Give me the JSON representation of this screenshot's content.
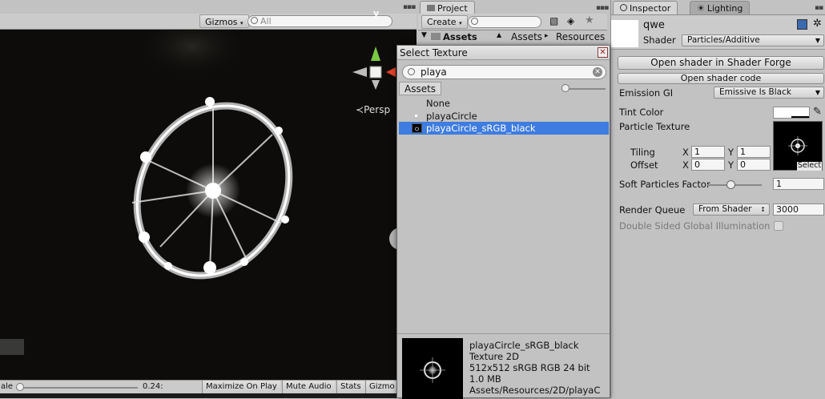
{
  "scene": {
    "gizmos_label": "Gizmos",
    "search_placeholder": "All",
    "persp_label": "Persp",
    "axis_y_label": "y"
  },
  "game_bar": {
    "scale_label": "ale",
    "scale_value": "0.24:",
    "maximize_label": "Maximize On Play",
    "mute_label": "Mute Audio",
    "stats_label": "Stats",
    "gizmos_label": "Gizmo"
  },
  "project": {
    "tab_label": "Project",
    "create_label": "Create",
    "path_root": "Assets",
    "breadcrumb": [
      "Assets",
      "Resources"
    ]
  },
  "dialog": {
    "title": "Select Texture",
    "search_value": "playa",
    "assets_tab": "Assets",
    "items": [
      {
        "label": "None",
        "selected": false
      },
      {
        "label": "playaCircle",
        "selected": false
      },
      {
        "label": "playaCircle_sRGB_black",
        "selected": true
      }
    ],
    "info": [
      "playaCircle_sRGB_black",
      "Texture 2D",
      "512x512 sRGB  RGB 24 bit",
      "1.0 MB",
      "Assets/Resources/2D/playaC"
    ]
  },
  "inspector": {
    "tab_inspector": "Inspector",
    "tab_lighting": "Lighting",
    "material_name": "qwe",
    "shader_label": "Shader",
    "shader_value": "Particles/Additive",
    "btn_shader_forge": "Open shader in Shader Forge",
    "btn_shader_code": "Open shader code",
    "emission_label": "Emission GI",
    "emission_value": "Emissive Is Black",
    "tint_label": "Tint Color",
    "particle_texture_label": "Particle Texture",
    "tiling_label": "Tiling",
    "offset_label": "Offset",
    "tiling_x": "1",
    "tiling_y": "1",
    "offset_x": "0",
    "offset_y": "0",
    "x_label": "X",
    "y_label": "Y",
    "select_label": "Select",
    "soft_label": "Soft Particles Factor",
    "soft_value": "1",
    "soft_slider_fraction": 0.35,
    "render_queue_label": "Render Queue",
    "render_queue_mode": "From Shader",
    "render_queue_value": "3000",
    "double_sided_label": "Double Sided Global Illumination",
    "double_sided_checked": false
  }
}
